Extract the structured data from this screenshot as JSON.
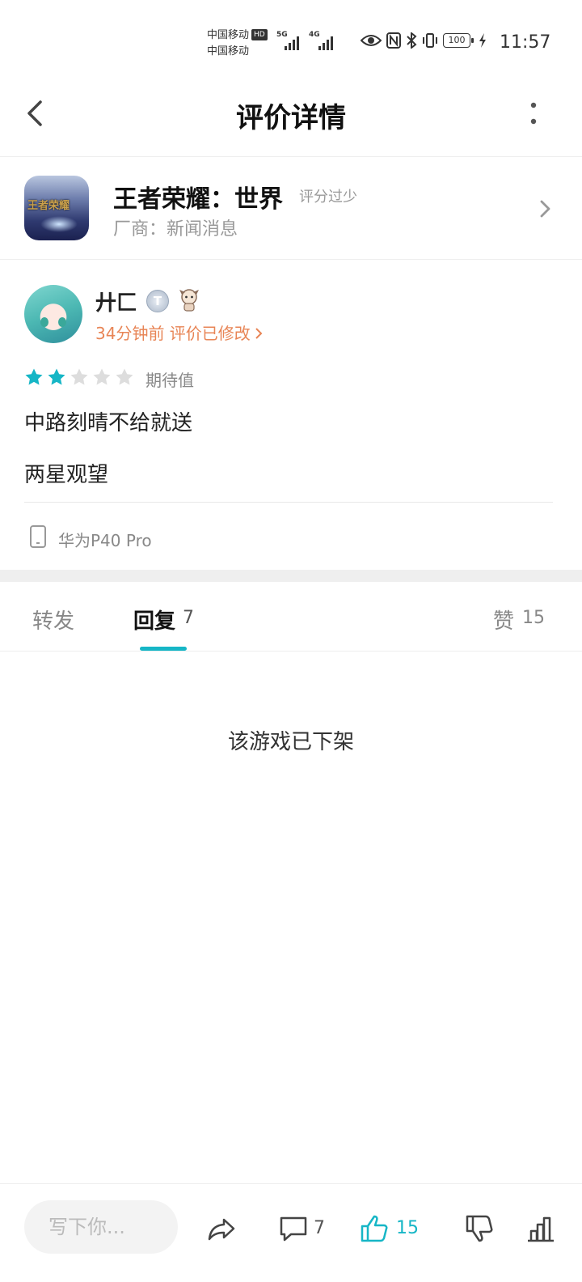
{
  "status_bar": {
    "carrier_1": "中国移动",
    "carrier_1_badge": "HD",
    "carrier_2": "中国移动",
    "signal_1_tag": "5G",
    "signal_2_tag": "4G",
    "battery": "100",
    "time": "11:57"
  },
  "header": {
    "title": "评价详情"
  },
  "game": {
    "name": "王者荣耀：世界",
    "rating_note": "评分过少",
    "vendor": "厂商：新闻消息",
    "logo_text": "王者荣耀"
  },
  "review": {
    "user_name": "廾匚",
    "level_badge": "T",
    "meta": "34分钟前 评价已修改",
    "rating": 2,
    "rating_max": 5,
    "rating_label": "期待值",
    "lines": [
      "中路刻晴不给就送",
      "两星观望"
    ],
    "device": "华为P40 Pro"
  },
  "tabs": {
    "forward_label": "转发",
    "reply_label": "回复",
    "reply_count": "7",
    "like_label": "赞",
    "like_count": "15"
  },
  "empty_message": "该游戏已下架",
  "bottom_bar": {
    "input_placeholder": "写下你...",
    "comment_count": "7",
    "like_count": "15"
  },
  "colors": {
    "accent": "#16b6c6",
    "meta_orange": "#e88556",
    "star_off": "#dddddd"
  }
}
